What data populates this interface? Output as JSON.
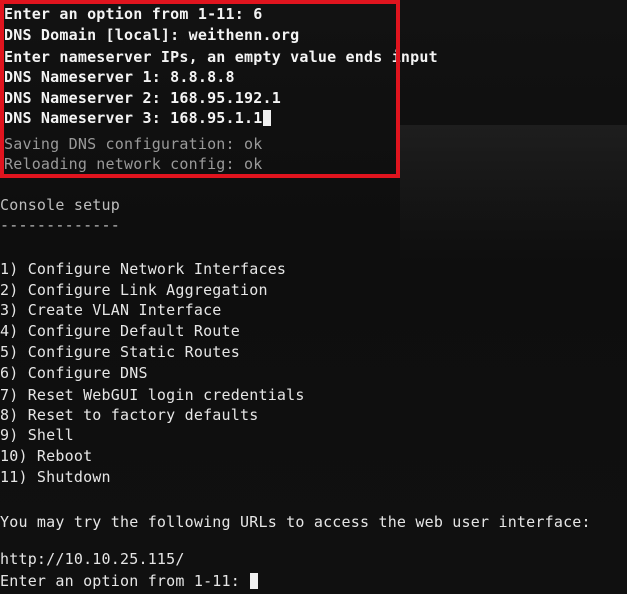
{
  "dns_prompt": {
    "option_prompt": "Enter an option from 1-11: 6",
    "domain_line": "DNS Domain [local]: weithenn.org",
    "instructions": "Enter nameserver IPs, an empty value ends input",
    "nameserver_1": "DNS Nameserver 1: 8.8.8.8",
    "nameserver_2": "DNS Nameserver 2: 168.95.192.1",
    "nameserver_3": "DNS Nameserver 3: 168.95.1.1"
  },
  "status": {
    "saving": "Saving DNS configuration: ok",
    "reloading": "Reloading network config: ok"
  },
  "console": {
    "title": "Console setup",
    "underline": "-------------",
    "menu": [
      "1) Configure Network Interfaces",
      "2) Configure Link Aggregation",
      "3) Create VLAN Interface",
      "4) Configure Default Route",
      "5) Configure Static Routes",
      "6) Configure DNS",
      "7) Reset WebGUI login credentials",
      "8) Reset to factory defaults",
      "9) Shell",
      "10) Reboot",
      "11) Shutdown"
    ],
    "url_notice": "You may try the following URLs to access the web user interface:",
    "url": "http://10.10.25.115/",
    "final_prompt": "Enter an option from 1-11: "
  },
  "colors": {
    "highlight": "#e0141e",
    "background": "#0d0d0d",
    "text": "#e6e6e6"
  }
}
